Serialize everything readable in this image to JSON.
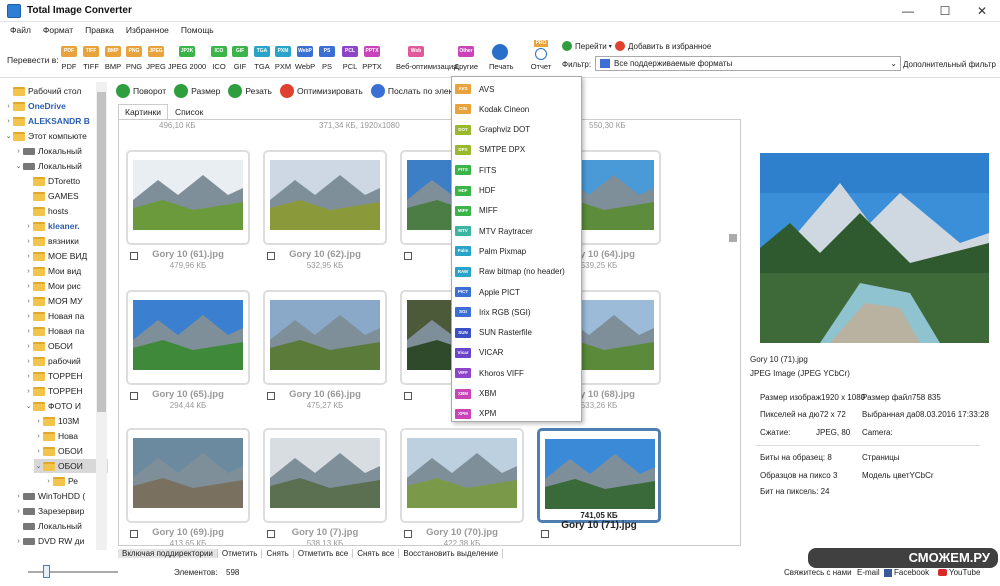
{
  "window": {
    "title": "Total Image Converter",
    "minimize": "—",
    "maximize": "☐",
    "close": "✕"
  },
  "menu": [
    "Файл",
    "Формат",
    "Правка",
    "Избранное",
    "Помощь"
  ],
  "toolbar": {
    "convert_label": "Перевести в:",
    "formats": [
      {
        "icon": "PDF",
        "label": "PDF",
        "color": "#e8a33c"
      },
      {
        "icon": "TIFF",
        "label": "TIFF",
        "color": "#e8a33c"
      },
      {
        "icon": "BMP",
        "label": "BMP",
        "color": "#e8a33c"
      },
      {
        "icon": "PNG",
        "label": "PNG",
        "color": "#e8a33c"
      },
      {
        "icon": "JPEG",
        "label": "JPEG",
        "color": "#e8a33c"
      },
      {
        "icon": "JP2K",
        "label": "JPEG 2000",
        "color": "#3bb54a"
      },
      {
        "icon": "ICO",
        "label": "ICO",
        "color": "#3bb54a"
      },
      {
        "icon": "GIF",
        "label": "GIF",
        "color": "#3bb54a"
      },
      {
        "icon": "TGA",
        "label": "TGA",
        "color": "#29a3c7"
      },
      {
        "icon": "PXM",
        "label": "PXM",
        "color": "#29a3c7"
      },
      {
        "icon": "WebP",
        "label": "WebP",
        "color": "#3b6fd4"
      },
      {
        "icon": "PS",
        "label": "PS",
        "color": "#3b6fd4"
      },
      {
        "icon": "PCL",
        "label": "PCL",
        "color": "#8e44c9"
      },
      {
        "icon": "PPTX",
        "label": "PPTX",
        "color": "#c944b9"
      },
      {
        "icon": "Web",
        "label": "Веб-оптимизация",
        "color": "#e05a9a"
      },
      {
        "icon": "Other",
        "label": "Другие",
        "color": "#c944b9"
      }
    ],
    "print_label": "Печать",
    "report_label": "Отчет",
    "report_badge": "PRO",
    "goto_label": "Перейти",
    "favorites_label": "Добавить в избранное",
    "filter_label": "Фильтр:",
    "filter_value": "Все поддерживаемые форматы",
    "extra_filter_label": "Дополнительный фильтр"
  },
  "actions": [
    {
      "label": "Поворот",
      "color": "#2e9e3e"
    },
    {
      "label": "Размер",
      "color": "#2e9e3e"
    },
    {
      "label": "Резать",
      "color": "#2e9e3e"
    },
    {
      "label": "Оптимизировать",
      "color": "#e0402e"
    },
    {
      "label": "Послать по элект",
      "color": "#3b6fd4"
    }
  ],
  "tree": [
    {
      "label": "Рабочий стол",
      "level": 0,
      "exp": "",
      "kind": "folder",
      "bold": false
    },
    {
      "label": "OneDrive",
      "level": 0,
      "exp": "›",
      "kind": "folder",
      "bold": true
    },
    {
      "label": "ALEKSANDR B",
      "level": 0,
      "exp": "›",
      "kind": "folder",
      "bold": true
    },
    {
      "label": "Этот компьюте",
      "level": 0,
      "exp": "⌄",
      "kind": "folder",
      "bold": false
    },
    {
      "label": "Локальный",
      "level": 1,
      "exp": "›",
      "kind": "drive",
      "bold": false
    },
    {
      "label": "Локальный",
      "level": 1,
      "exp": "⌄",
      "kind": "drive",
      "bold": false
    },
    {
      "label": "DToretto",
      "level": 2,
      "exp": "",
      "kind": "folder",
      "bold": false
    },
    {
      "label": "GAMES",
      "level": 2,
      "exp": "",
      "kind": "folder",
      "bold": false
    },
    {
      "label": "hosts",
      "level": 2,
      "exp": "",
      "kind": "folder",
      "bold": false
    },
    {
      "label": "kleaner.",
      "level": 2,
      "exp": "›",
      "kind": "folder",
      "bold": true
    },
    {
      "label": "вязники",
      "level": 2,
      "exp": "›",
      "kind": "folder",
      "bold": false
    },
    {
      "label": "МОЕ ВИД",
      "level": 2,
      "exp": "›",
      "kind": "folder",
      "bold": false
    },
    {
      "label": "Мои вид",
      "level": 2,
      "exp": "›",
      "kind": "folder",
      "bold": false
    },
    {
      "label": "Мои рис",
      "level": 2,
      "exp": "›",
      "kind": "folder",
      "bold": false
    },
    {
      "label": "МОЯ МУ",
      "level": 2,
      "exp": "›",
      "kind": "folder",
      "bold": false
    },
    {
      "label": "Новая па",
      "level": 2,
      "exp": "›",
      "kind": "folder",
      "bold": false
    },
    {
      "label": "Новая па",
      "level": 2,
      "exp": "›",
      "kind": "folder",
      "bold": false
    },
    {
      "label": "ОБОИ",
      "level": 2,
      "exp": "›",
      "kind": "folder",
      "bold": false
    },
    {
      "label": "рабочий",
      "level": 2,
      "exp": "›",
      "kind": "folder",
      "bold": false
    },
    {
      "label": "ТОРРЕН",
      "level": 2,
      "exp": "›",
      "kind": "folder",
      "bold": false
    },
    {
      "label": "ТОРРЕН",
      "level": 2,
      "exp": "›",
      "kind": "folder",
      "bold": false
    },
    {
      "label": "ФОТО И",
      "level": 2,
      "exp": "⌄",
      "kind": "folder",
      "bold": false
    },
    {
      "label": "103М",
      "level": 3,
      "exp": "›",
      "kind": "folder",
      "bold": false
    },
    {
      "label": "Нова",
      "level": 3,
      "exp": "›",
      "kind": "folder",
      "bold": false
    },
    {
      "label": "ОБОИ",
      "level": 3,
      "exp": "›",
      "kind": "folder",
      "bold": false
    },
    {
      "label": "ОБОИ",
      "level": 3,
      "exp": "⌄",
      "kind": "folder",
      "bold": false,
      "selected": true
    },
    {
      "label": "Ре",
      "level": 4,
      "exp": "›",
      "kind": "folder",
      "bold": false
    },
    {
      "label": "WinToHDD (",
      "level": 1,
      "exp": "›",
      "kind": "drive",
      "bold": false
    },
    {
      "label": "Зарезервир",
      "level": 1,
      "exp": "›",
      "kind": "drive",
      "bold": false
    },
    {
      "label": "Локальный",
      "level": 1,
      "exp": "",
      "kind": "drive",
      "bold": false
    },
    {
      "label": "DVD RW ди",
      "level": 1,
      "exp": "›",
      "kind": "drive",
      "bold": false
    }
  ],
  "tabs": [
    "Картинки",
    "Список"
  ],
  "top_row_sizes": [
    "496,10 КБ",
    "371,34 КБ, 1920x1080",
    "550,30 КБ"
  ],
  "thumbnails": [
    {
      "name": "Gory 10 (61).jpg",
      "size": "479,96 КБ",
      "sky": "#e9eef2",
      "land": "#6a9a3c"
    },
    {
      "name": "Gory 10 (62).jpg",
      "size": "532,95 КБ",
      "sky": "#cdd8e4",
      "land": "#8a9a3a"
    },
    {
      "name": "",
      "size": "",
      "sky": "#3d7fc7",
      "land": "#4b7d45"
    },
    {
      "name": "Gory 10 (64).jpg",
      "size": "539,25 КБ",
      "sky": "#4a9ad8",
      "land": "#5d8c3d"
    },
    {
      "name": "Gory 10 (65).jpg",
      "size": "294,44 КБ",
      "sky": "#3b7fd0",
      "land": "#3f8a3a"
    },
    {
      "name": "Gory 10 (66).jpg",
      "size": "475,27 КБ",
      "sky": "#8aa8c8",
      "land": "#5b7b3a"
    },
    {
      "name": "",
      "size": "",
      "sky": "#4d5a3a",
      "land": "#2f4a2a"
    },
    {
      "name": "Gory 10 (68).jpg",
      "size": "533,26 КБ",
      "sky": "#9bbbd8",
      "land": "#5a8a3a"
    },
    {
      "name": "Gory 10 (69).jpg",
      "size": "413,65 КБ",
      "sky": "#6b8aa0",
      "land": "#7a7060"
    },
    {
      "name": "Gory 10 (7).jpg",
      "size": "538,13 КБ",
      "sky": "#d8dde2",
      "land": "#5a7050"
    },
    {
      "name": "Gory 10 (70).jpg",
      "size": "422,38 КБ",
      "sky": "#bcd0e0",
      "land": "#7a9a4a"
    },
    {
      "name": "Gory 10 (71).jpg",
      "size": "741,05 КБ",
      "sky": "#3b8ad8",
      "land": "#3a6a3a",
      "selected": true
    }
  ],
  "dropdown": [
    {
      "icon": "AVS",
      "label": "AVS",
      "color": "#e8a33c"
    },
    {
      "icon": "CIN",
      "label": "Kodak Cineon",
      "color": "#e8a33c"
    },
    {
      "icon": "DOT",
      "label": "Graphviz DOT",
      "color": "#9ab82e"
    },
    {
      "icon": "DPX",
      "label": "SMTPE DPX",
      "color": "#9ab82e"
    },
    {
      "icon": "FITS",
      "label": "FITS",
      "color": "#3bb54a"
    },
    {
      "icon": "HDF",
      "label": "HDF",
      "color": "#3bb54a"
    },
    {
      "icon": "MIFF",
      "label": "MIFF",
      "color": "#3bb54a"
    },
    {
      "icon": "MTV",
      "label": "MTV Raytracer",
      "color": "#3bb5a0"
    },
    {
      "icon": "Palm",
      "label": "Palm Pixmap",
      "color": "#29a3c7"
    },
    {
      "icon": "RAW",
      "label": "Raw bitmap (no header)",
      "color": "#29a3c7"
    },
    {
      "icon": "PICT",
      "label": "Apple PICT",
      "color": "#3b6fd4"
    },
    {
      "icon": "SGI",
      "label": "Irix RGB (SGI)",
      "color": "#3b6fd4"
    },
    {
      "icon": "SUN",
      "label": "SUN Rasterfile",
      "color": "#3b4fc4"
    },
    {
      "icon": "Vicar",
      "label": "VICAR",
      "color": "#6a44c9"
    },
    {
      "icon": "VIFF",
      "label": "Khoros VIFF",
      "color": "#8e44c9"
    },
    {
      "icon": "XBM",
      "label": "XBM",
      "color": "#c944b9"
    },
    {
      "icon": "XPM",
      "label": "XPM",
      "color": "#c944b9"
    }
  ],
  "info": {
    "filename": "Gory 10 (71).jpg",
    "type": "JPEG Image (JPEG YCbCr)",
    "dimensions_label": "Размер изображ",
    "dimensions_value": "1920 x 1080",
    "filesize_label": "Размер файл",
    "filesize_value": "758 835",
    "ppi_label": "Пикселей на дю",
    "ppi_value": "72 x 72",
    "selected_label": "Выбранная да",
    "selected_value": "08.03.2016 17:33:28",
    "compression_label": "Сжатие:",
    "compression_value": "JPEG, 80",
    "camera_label": "Camera:",
    "bits_label": "Биты на образец:",
    "bits_value": "8",
    "pages_label": "Страницы",
    "samples_label": "Образцов на пиксо",
    "samples_value": "3",
    "colormodel_label": "Модель цвет",
    "colormodel_value": "YCbCr",
    "bpp_label": "Бит на пиксель:",
    "bpp_value": "24"
  },
  "bottom_buttons": [
    "Включая поддиректории",
    "Отметить",
    "Снять",
    "Отметить все",
    "Снять все",
    "Восстановить выделение"
  ],
  "status": {
    "elements_label": "Элементов:",
    "elements_value": "598",
    "contact_label": "Свяжитесь с нами",
    "email_label": "E-mail",
    "facebook_label": "Facebook",
    "youtube_label": "YouTube",
    "watermark": "СМОЖЕМ.РУ",
    "zoom_fraction": 0.2
  }
}
